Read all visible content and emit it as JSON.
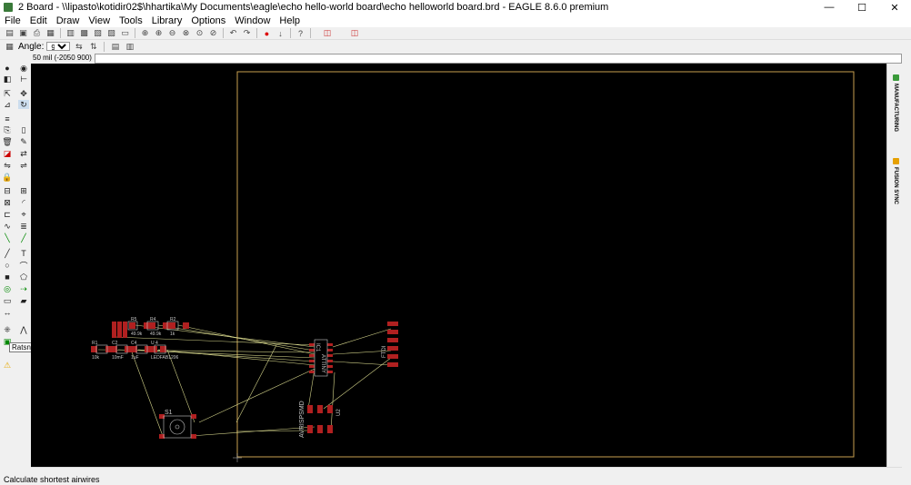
{
  "window": {
    "title": "2 Board - \\\\lipasto\\kotidir02$\\hhartika\\My Documents\\eagle\\echo hello-world board\\echo helloworld board.brd - EAGLE 8.6.0 premium",
    "minimize": "—",
    "maximize": "☐",
    "close": "✕"
  },
  "menu": [
    "File",
    "Edit",
    "Draw",
    "View",
    "Tools",
    "Library",
    "Options",
    "Window",
    "Help"
  ],
  "toolbar2": {
    "angle_label": "Angle:",
    "angle_value": "90"
  },
  "coordinate_readout": "50 mil (-2050 900)",
  "tooltip": "Ratsnest",
  "status": "Calculate shortest airwires",
  "right_panel": [
    "MANUFACTURING",
    "FUSION SYNC"
  ],
  "colors": {
    "canvas": "#000000",
    "board_outline": "#c8a050",
    "pad": "#b02020",
    "airwire": "#d4d48a",
    "silk": "#c8c8c8"
  },
  "parts": {
    "r5": "R5",
    "r5v": "49.9k",
    "r4": "R4",
    "r4v": "49.9k",
    "r2": "R2",
    "r2v": "1k",
    "r1": "R1",
    "r1v": "10k",
    "c2": "C2",
    "c2v": "10mF",
    "c4": "C4",
    "c4v": "1uF",
    "u3": "U 4",
    "u3v": "LEDFAB1206",
    "ic1": "IC1",
    "ic1v": "ATTINY",
    "sw": "S1",
    "avr": "AVRISPSMD",
    "u2": "U2",
    "ftdi": "FTDI"
  }
}
